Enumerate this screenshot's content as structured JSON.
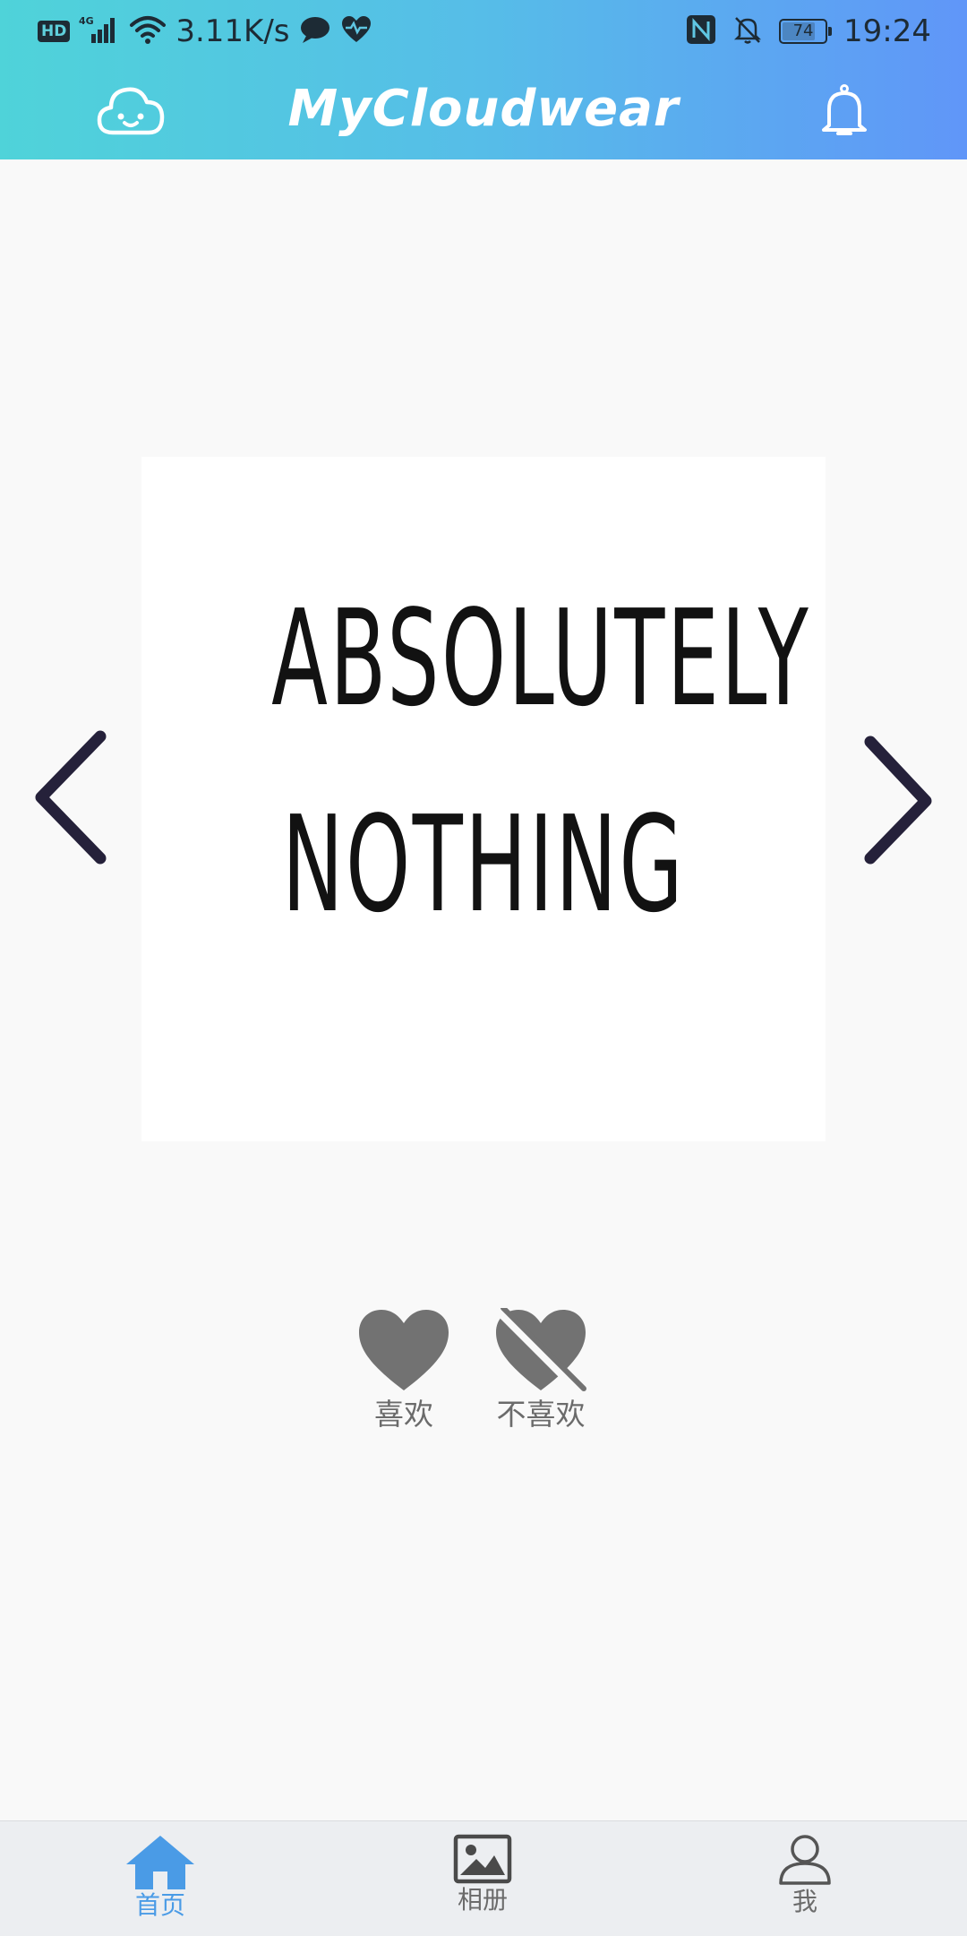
{
  "status_bar": {
    "hd_badge": "HD",
    "network": "4G",
    "net_speed": "3.11K/s",
    "battery_level": "74",
    "time": "19:24"
  },
  "app_bar": {
    "title": "MyCloudwear",
    "left_icon": "cloud-face-icon",
    "right_icon": "bell-icon"
  },
  "photo": {
    "text_line1": "ABSOLUTELY",
    "text_line2": "NOTHING",
    "prev_icon": "chevron-left-icon",
    "next_icon": "chevron-right-icon"
  },
  "actions": {
    "like_label": "喜欢",
    "dislike_label": "不喜欢"
  },
  "bottom_nav": {
    "items": [
      {
        "label": "首页",
        "icon": "home-icon",
        "active": true
      },
      {
        "label": "相册",
        "icon": "image-icon",
        "active": false
      },
      {
        "label": "我",
        "icon": "user-icon",
        "active": false
      }
    ]
  },
  "colors": {
    "header_gradient_start": "#4fd3d9",
    "header_gradient_end": "#6096f8",
    "active_nav": "#4a9be6",
    "inactive_text": "#6b6b6b",
    "icon_gray": "#707070",
    "arrow_color": "#25213a"
  }
}
